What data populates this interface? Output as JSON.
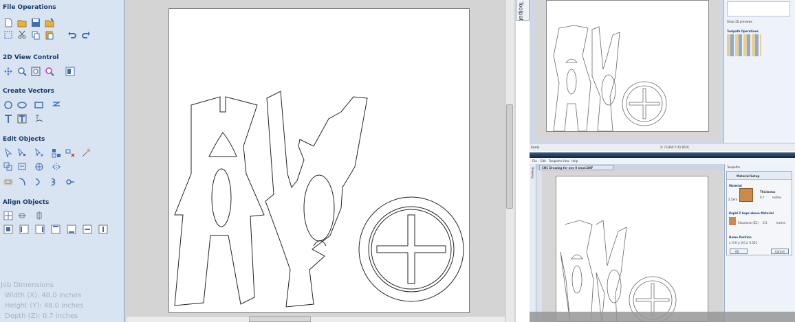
{
  "left_panel": {
    "sections": [
      {
        "title": "File Operations"
      },
      {
        "title": "2D View Control"
      },
      {
        "title": "Create Vectors"
      },
      {
        "title": "Edit Objects"
      },
      {
        "title": "Align Objects"
      }
    ],
    "job_dimensions": {
      "title": "Job Dimensions",
      "width": "Width  (X): 48.0 inches",
      "height": "Height (Y): 48.0 inches",
      "depth": "Depth  (Z): 0.7 inches"
    }
  },
  "tabs": {
    "toolpaths": "Toolpaths"
  },
  "right_top": {
    "show_previews": "Show 2D previews",
    "toolpath_ops": "Toolpath Operations",
    "status_ready": "Ready",
    "coords": "X: 7.0360 Y: 41.8516"
  },
  "right_bottom": {
    "menu": [
      "File",
      "Edit",
      "Toolpaths",
      "View",
      "Help"
    ],
    "tab_label": "CNC Drawing for one 0 stool.DXF",
    "panel_title": "Toolpaths",
    "drawing_tab": "Drawing",
    "dialog": {
      "title": "Material Setup",
      "material": "Material",
      "thickness": "Thickness",
      "thickness_val": "0.7",
      "units": "inches",
      "zzero": "Z Zero",
      "rapid": "Rapid Z Gaps above Material",
      "clearance": "Clearance (Z1)",
      "clearance_val": "0.5",
      "home": "Home Position",
      "home_vals": "x: 0.0   y: 0.0   z: 0.501",
      "ok": "OK",
      "cancel": "Cancel"
    }
  },
  "colors": {
    "panel_bg": "#d9e4f2",
    "section_title": "#173a6b",
    "icon_blue": "#3f6fb5",
    "icon_yellow": "#e3b43b"
  }
}
